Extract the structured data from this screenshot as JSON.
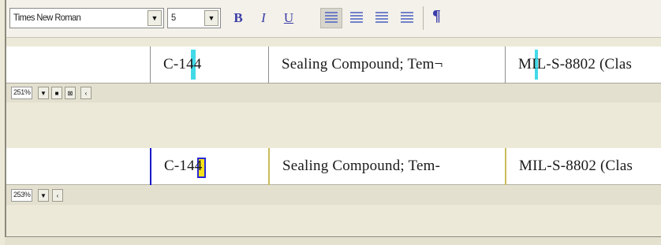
{
  "toolbar": {
    "font_name": "Times New Roman",
    "font_size": "5",
    "dropdown_glyph": "▼",
    "bold": "B",
    "italic": "I",
    "underline": "U",
    "paragraph_mark": "¶",
    "alignments": [
      "align-left-icon",
      "align-center-icon",
      "align-right-icon",
      "align-justify-icon"
    ]
  },
  "panels": [
    {
      "row": {
        "cells": [
          "",
          "C-144",
          "Sealing Compound; Tem¬",
          "MIL-S-8802 (Clas"
        ]
      },
      "zoom": "251%",
      "controls": [
        "▼",
        "■",
        "⊠",
        "‹"
      ]
    },
    {
      "row": {
        "cells": [
          "",
          "C-144",
          "Sealing Compound; Tem-",
          "MIL-S-8802 (Clas"
        ]
      },
      "zoom": "253%",
      "controls": [
        "▼",
        "‹"
      ]
    }
  ],
  "colors": {
    "highlight_cyan": "#2ed6e6",
    "highlight_yellow": "#f5e21a",
    "accent_blue": "#1818c8"
  }
}
